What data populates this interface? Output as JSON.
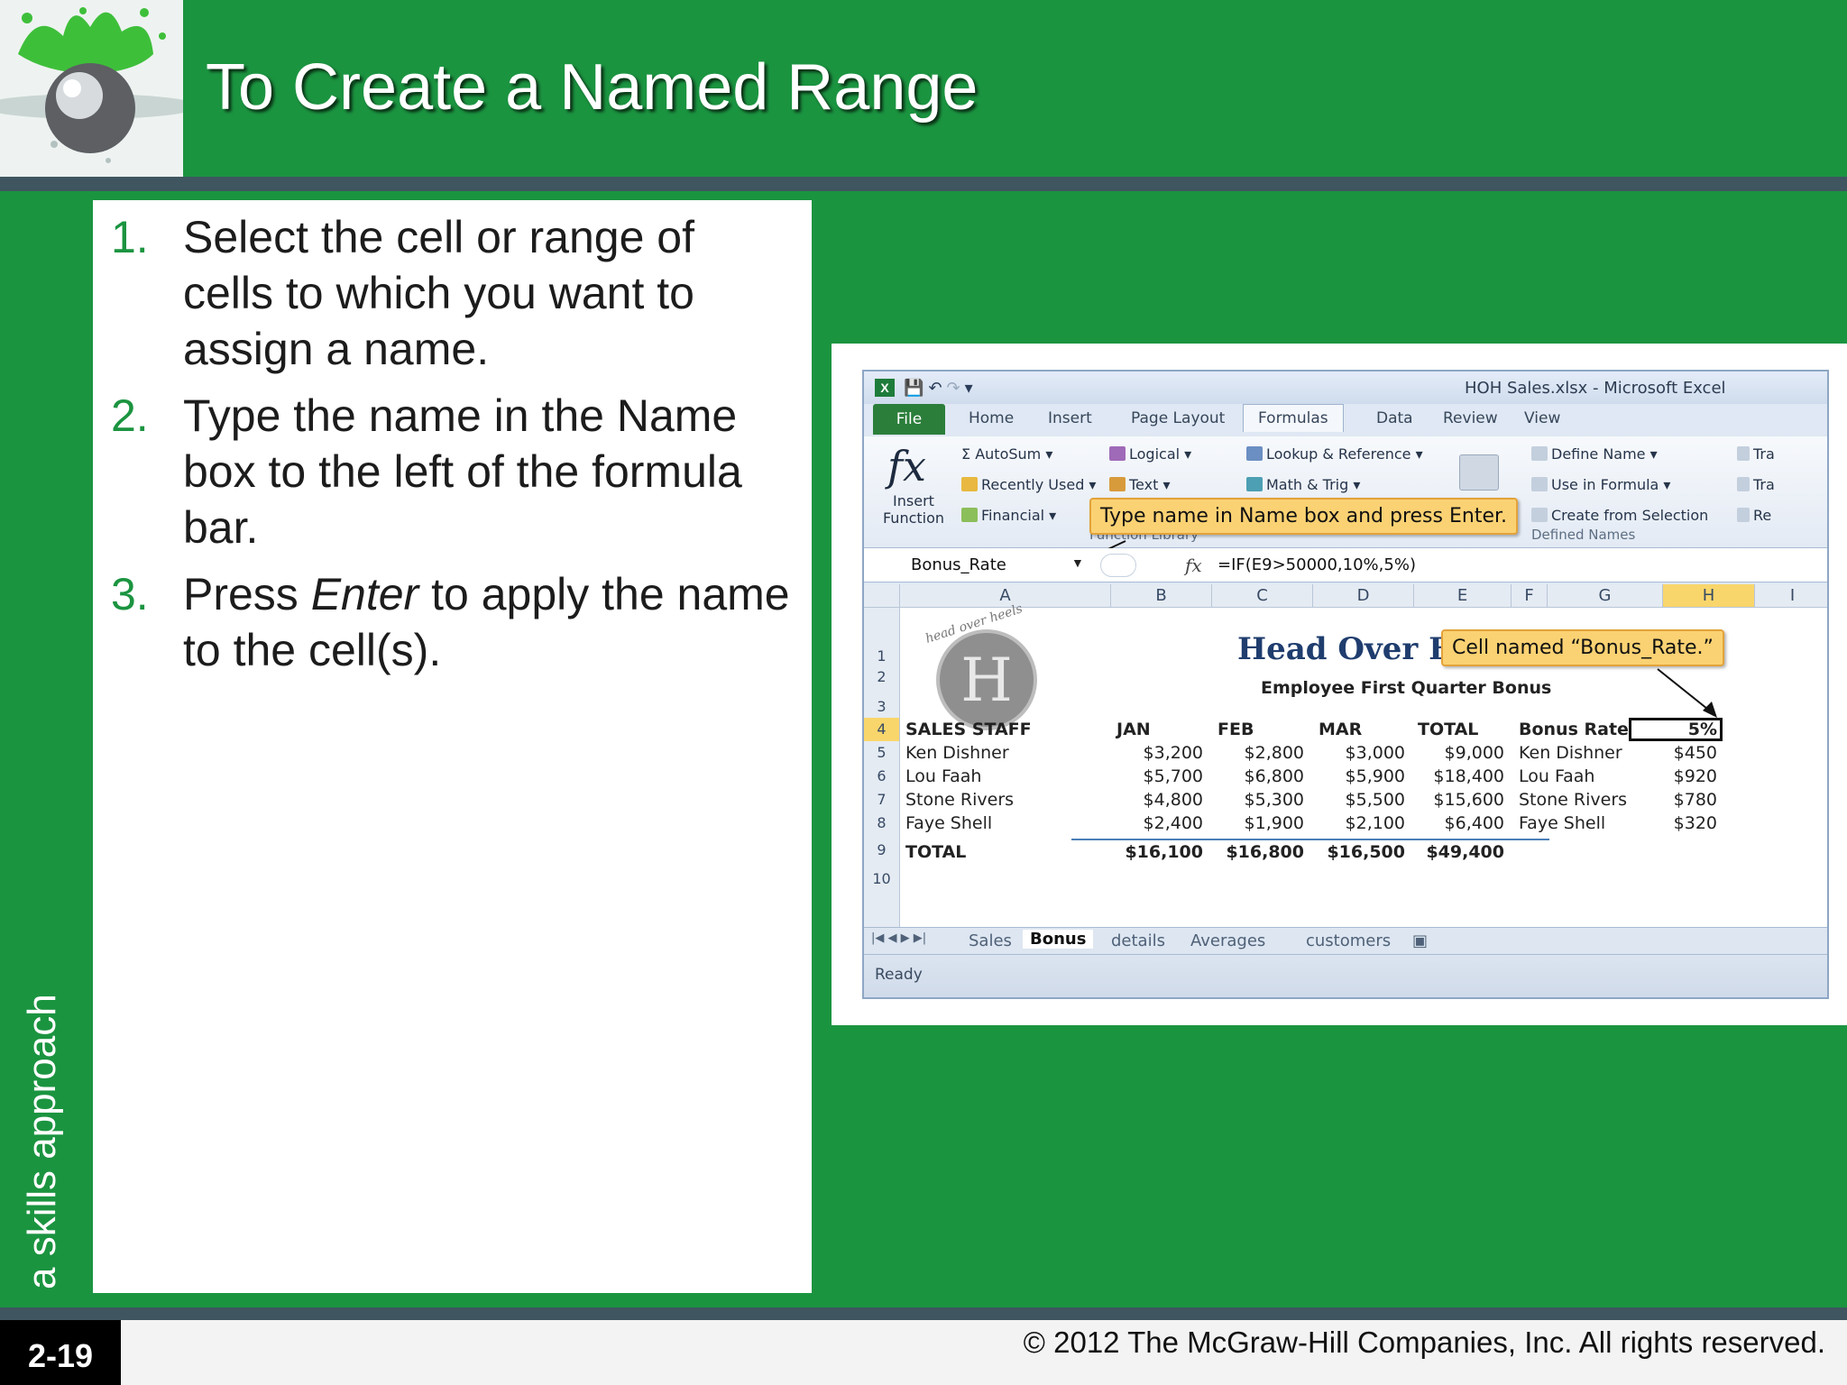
{
  "slide": {
    "title": "To Create a Named Range",
    "side_text": "a skills approach",
    "slide_number": "2-19",
    "copyright": "© 2012 The McGraw-Hill Companies, Inc. All rights reserved."
  },
  "steps": [
    {
      "num": "1.",
      "pre": "Select the cell or range of cells to which you want to assign a name.",
      "em": "",
      "post": ""
    },
    {
      "num": "2.",
      "pre": "Type the name in the Name box to the left of the formula bar.",
      "em": "",
      "post": ""
    },
    {
      "num": "3.",
      "pre": "Press ",
      "em": "Enter",
      "post": " to apply the name to the cell(s)."
    }
  ],
  "excel": {
    "window_title": "HOH Sales.xlsx - Microsoft Excel",
    "app_icon": "X",
    "tabs": [
      "File",
      "Home",
      "Insert",
      "Page Layout",
      "Formulas",
      "Data",
      "Review",
      "View"
    ],
    "active_tab": "Formulas",
    "ribbon": {
      "insert_function": "Insert Function",
      "function_library": {
        "label": "Function Library",
        "items": [
          "AutoSum",
          "Recently Used",
          "Financial",
          "Logical",
          "Text",
          "Lookup & Reference",
          "Math & Trig"
        ]
      },
      "defined_names": {
        "label": "Defined Names",
        "items": [
          "Define Name",
          "Use in Formula",
          "Create from Selection"
        ]
      },
      "truncated_items": [
        "Tra",
        "Tra",
        "Re"
      ]
    },
    "callouts": {
      "name_box": "Type name in Name box and press Enter.",
      "cell_named": "Cell named “Bonus_Rate.”"
    },
    "name_box_value": "Bonus_Rate",
    "formula": "=IF(E9>50000,10%,5%)",
    "fx_label": "fx",
    "columns": [
      "A",
      "B",
      "C",
      "D",
      "E",
      "F",
      "G",
      "H",
      "I"
    ],
    "selected_column": "H",
    "row_numbers": [
      "1",
      "2",
      "3",
      "4",
      "5",
      "6",
      "7",
      "8",
      "9",
      "10"
    ],
    "selected_row": "4",
    "sheet_title": "Head Over Heels Spa",
    "sheet_subtitle": "Employee First Quarter Bonus",
    "logo_letter": "H",
    "logo_text": "head over heels",
    "headers": [
      "SALES STAFF",
      "JAN",
      "FEB",
      "MAR",
      "TOTAL"
    ],
    "rows": [
      [
        "Ken Dishner",
        "$3,200",
        "$2,800",
        "$3,000",
        "$9,000"
      ],
      [
        "Lou Faah",
        "$5,700",
        "$6,800",
        "$5,900",
        "$18,400"
      ],
      [
        "Stone Rivers",
        "$4,800",
        "$5,300",
        "$5,500",
        "$15,600"
      ],
      [
        "Faye Shell",
        "$2,400",
        "$1,900",
        "$2,100",
        "$6,400"
      ]
    ],
    "total_row": [
      "TOTAL",
      "$16,100",
      "$16,800",
      "$16,500",
      "$49,400"
    ],
    "bonus": {
      "header": "Bonus Rate",
      "rate": "5%",
      "rows": [
        [
          "Ken Dishner",
          "$450"
        ],
        [
          "Lou Faah",
          "$920"
        ],
        [
          "Stone Rivers",
          "$780"
        ],
        [
          "Faye Shell",
          "$320"
        ]
      ]
    },
    "sheet_tabs": [
      "Sales",
      "Bonus",
      "details",
      "Averages",
      "customers"
    ],
    "active_sheet": "Bonus",
    "status": "Ready"
  },
  "colors": {
    "slide_green": "#1b9440",
    "band": "#3f5660",
    "callout": "#fbd273"
  }
}
